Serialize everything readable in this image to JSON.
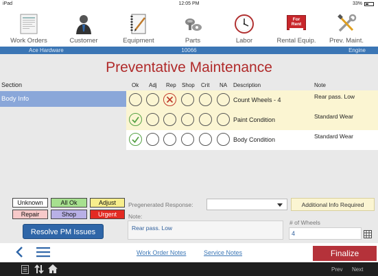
{
  "status_bar": {
    "device": "iPad",
    "time": "12:05 PM",
    "battery": "33%"
  },
  "toolbar": [
    {
      "label": "Work Orders",
      "icon": "work-orders-icon"
    },
    {
      "label": "Customer",
      "icon": "customer-icon"
    },
    {
      "label": "Equipment",
      "icon": "equipment-icon"
    },
    {
      "label": "Parts",
      "icon": "parts-icon"
    },
    {
      "label": "Labor",
      "icon": "clock-icon"
    },
    {
      "label": "Rental Equip.",
      "icon": "for-rent-icon"
    },
    {
      "label": "Prev. Maint.",
      "icon": "tools-icon"
    }
  ],
  "rent_sign": {
    "line1": "For",
    "line2": "Rent"
  },
  "info_bar": {
    "customer": "Ace Hardware",
    "number": "10066",
    "equipment": "Engine"
  },
  "page_title": "Preventative Maintenance",
  "section": {
    "header": "Section",
    "items": [
      "Body Info"
    ]
  },
  "grid": {
    "columns": [
      "Ok",
      "Adj",
      "Rep",
      "Shop",
      "Crit",
      "NA",
      "Description",
      "Note"
    ],
    "rows": [
      {
        "selected": "Rep",
        "description": "Count Wheels - 4",
        "note": "Rear pass. Low"
      },
      {
        "selected": "Ok",
        "description": "Paint Condition",
        "note": "Standard Wear"
      },
      {
        "selected": "Ok",
        "description": "Body Condition",
        "note": "Standard Wear"
      }
    ]
  },
  "status_buttons": {
    "unknown": "Unknown",
    "all_ok": "All Ok",
    "adjust": "Adjust",
    "repair": "Repair",
    "shop": "Shop",
    "urgent": "Urgent"
  },
  "resolve_button": "Resolve PM Issues",
  "pregenerated": {
    "label": "Pregenerated Response:",
    "value": ""
  },
  "additional_info_button": "Additional Info Required",
  "note": {
    "label": "Note:",
    "value": "Rear pass. Low"
  },
  "wheels": {
    "label": "# of Wheels",
    "value": "4"
  },
  "links": {
    "work_order_notes": "Work Order Notes",
    "service_notes": "Service Notes"
  },
  "finalize_button": "Finalize",
  "footer": {
    "prev": "Prev",
    "next": "Next"
  },
  "colors": {
    "accent_blue": "#3b76b5",
    "title_red": "#b02a2a",
    "finalize_red": "#b5323a",
    "row_yellow": "#fbf5d2",
    "ok_green": "#55a144",
    "rep_red": "#c0392b"
  }
}
